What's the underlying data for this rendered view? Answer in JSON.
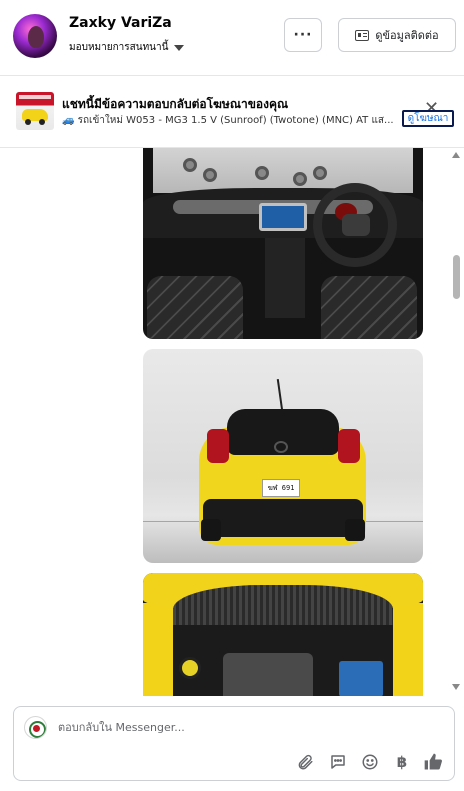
{
  "header": {
    "customer_name": "Zaxky VariZa",
    "assign_label": "มอบหมายการสนทนานี้",
    "more_label": "···",
    "contact_info_label": "ดูข้อมูลติดต่อ"
  },
  "ad_banner": {
    "title": "แชทนี้มีข้อความตอบกลับต่อโฆษณาของคุณ",
    "subtitle": "🚙 รถเข้าใหม่ W053 - MG3 1.5 V (Sunroof) (Twotone) (MNC) AT แส...",
    "close_label": "✕",
    "view_ad_label": "ดูโฆษณา"
  },
  "thread": {
    "photos": [
      {
        "name": "interior-photo"
      },
      {
        "name": "rear-exterior-photo",
        "plate": "ฆฬ 691"
      },
      {
        "name": "engine-bay-photo"
      }
    ]
  },
  "composer": {
    "placeholder": "ตอบกลับใน Messenger...",
    "tools": [
      "attachment-icon",
      "saved-reply-icon",
      "emoji-icon",
      "baht-payment-icon",
      "like-icon"
    ],
    "baht_symbol": "฿"
  },
  "colors": {
    "link": "#1b74e4",
    "border": "#ccd0d5",
    "car_yellow": "#f1d61e"
  }
}
